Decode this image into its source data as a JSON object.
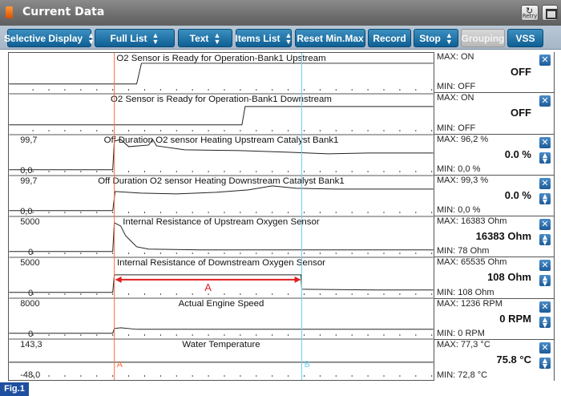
{
  "window": {
    "title": "Current Data",
    "retry_label": "Retry"
  },
  "toolbar": {
    "buttons": [
      {
        "label": "Selective Display",
        "spinner": true,
        "disabled": false
      },
      {
        "label": "Full List",
        "spinner": true,
        "disabled": false
      },
      {
        "label": "Text",
        "spinner": true,
        "disabled": false
      },
      {
        "label": "Items List",
        "spinner": true,
        "disabled": false
      },
      {
        "label": "Reset Min.Max",
        "spinner": false,
        "disabled": false
      },
      {
        "label": "Record",
        "spinner": false,
        "disabled": false
      },
      {
        "label": "Stop",
        "spinner": true,
        "disabled": false
      },
      {
        "label": "Grouping",
        "spinner": false,
        "disabled": true
      },
      {
        "label": "VSS",
        "spinner": false,
        "disabled": false
      }
    ]
  },
  "channels": [
    {
      "name": "O2 Sensor is Ready for Operation-Bank1 Upstream",
      "scale_top": "",
      "scale_bottom": "",
      "max": "MAX: ON",
      "current": "OFF",
      "min": "MIN: OFF",
      "scroll": false
    },
    {
      "name": "O2 Sensor is Ready for Operation-Bank1 Downstream",
      "scale_top": "",
      "scale_bottom": "",
      "max": "MAX: ON",
      "current": "OFF",
      "min": "MIN: OFF",
      "scroll": false
    },
    {
      "name": "Off Duration O2 sensor Heating Upstream Catalyst Bank1",
      "scale_top": "99,7",
      "scale_bottom": "0,0",
      "max": "MAX:  96,2 %",
      "current": "0.0 %",
      "min": "MIN:   0,0 %",
      "scroll": true
    },
    {
      "name": "Off Duration O2 sensor Heating Downstream Catalyst Bank1",
      "scale_top": "99,7",
      "scale_bottom": "0,0",
      "max": "MAX:  99,3 %",
      "current": "0.0 %",
      "min": "MIN:   0,0 %",
      "scroll": true
    },
    {
      "name": "Internal Resistance of Upstream Oxygen Sensor",
      "scale_top": "5000",
      "scale_bottom": "0",
      "max": "MAX: 16383 Ohm",
      "current": "16383 Ohm",
      "min": "MIN:   78 Ohm",
      "scroll": true
    },
    {
      "name": "Internal Resistance of Downstream Oxygen Sensor",
      "scale_top": "5000",
      "scale_bottom": "0",
      "max": "MAX: 65535 Ohm",
      "current": "108 Ohm",
      "min": "MIN:  108 Ohm",
      "scroll": true
    },
    {
      "name": "Actual Engine Speed",
      "scale_top": "8000",
      "scale_bottom": "0",
      "max": "MAX:  1236 RPM",
      "current": "0 RPM",
      "min": "MIN:    0 RPM",
      "scroll": true
    },
    {
      "name": "Water Temperature",
      "scale_top": "143,3",
      "scale_bottom": "-48,0",
      "max": "MAX:  77,3 °C",
      "current": "75.8 °C",
      "min": "MIN:  72,8 °C",
      "scroll": true
    }
  ],
  "markers": {
    "cursor_a": "A",
    "cursor_b": "B",
    "interval_label": "A"
  },
  "colors": {
    "cursor_a": "#ff6a3d",
    "cursor_b": "#6cd6e8",
    "interval": "#e02020",
    "accent": "#1d5c99"
  },
  "figure_label": "Fig.1"
}
